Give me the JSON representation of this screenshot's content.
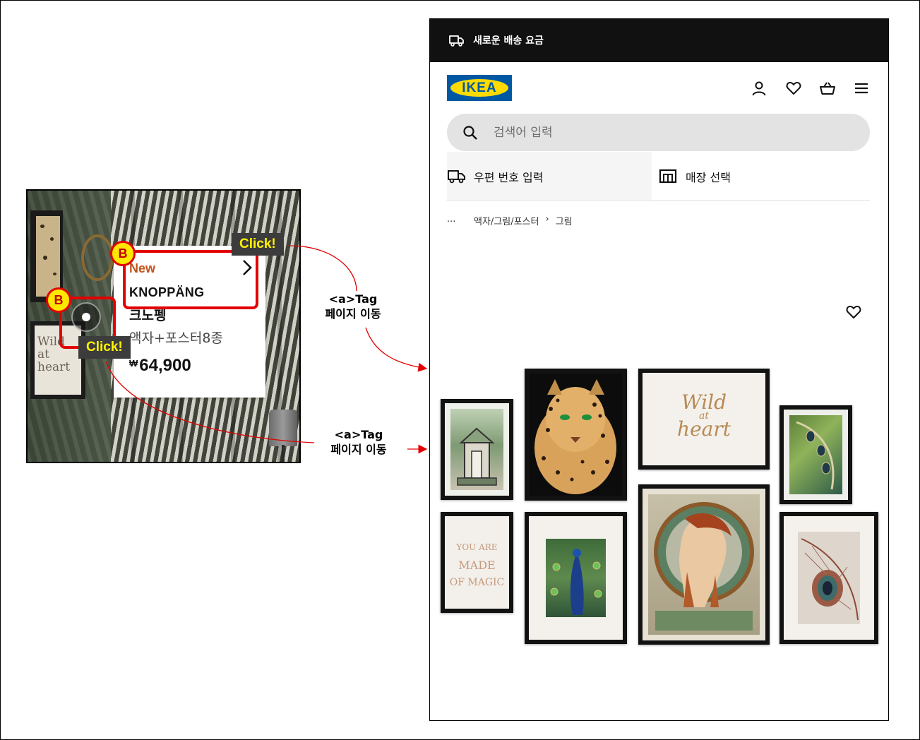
{
  "left_panel": {
    "product_card": {
      "badge": "New",
      "name": "KNOPPÄNG",
      "korean_name": "크노펭",
      "description": "액자+포스터8종",
      "currency_symbol": "₩",
      "price": "64,900"
    },
    "frame_text": "Wild at heart",
    "annotations": {
      "badge_letter": "B",
      "click_label": "Click!"
    }
  },
  "arrows": {
    "upper_label_line1": "<a>Tag",
    "upper_label_line2": "페이지 이동",
    "lower_label_line1": "<a>Tag",
    "lower_label_line2": "페이지 이동"
  },
  "page": {
    "promo": {
      "icon": "delivery-truck-icon",
      "text": "새로운 배송 요금"
    },
    "logo": "IKEA",
    "header_icons": [
      "user-icon",
      "heart-icon",
      "shopping-basket-icon",
      "hamburger-menu-icon"
    ],
    "search": {
      "placeholder": "검색어 입력",
      "value": ""
    },
    "location": {
      "postal_label": "우편 번호 입력",
      "store_label": "매장 선택"
    },
    "breadcrumb": {
      "ellipsis": "...",
      "items": [
        "액자/그림/포스터",
        "그림"
      ],
      "separator": "›"
    },
    "gallery_texts": {
      "wild_line1": "Wild",
      "wild_line2": "at",
      "wild_line3": "heart",
      "magic_line1": "YOU ARE",
      "magic_line2": "MADE",
      "magic_line3": "OF MAGIC"
    },
    "colors": {
      "promo_bg": "#111111",
      "ikea_blue": "#0058a3",
      "ikea_yellow": "#ffdb00",
      "new_badge": "#c2531c",
      "highlight": "#e30000"
    }
  }
}
